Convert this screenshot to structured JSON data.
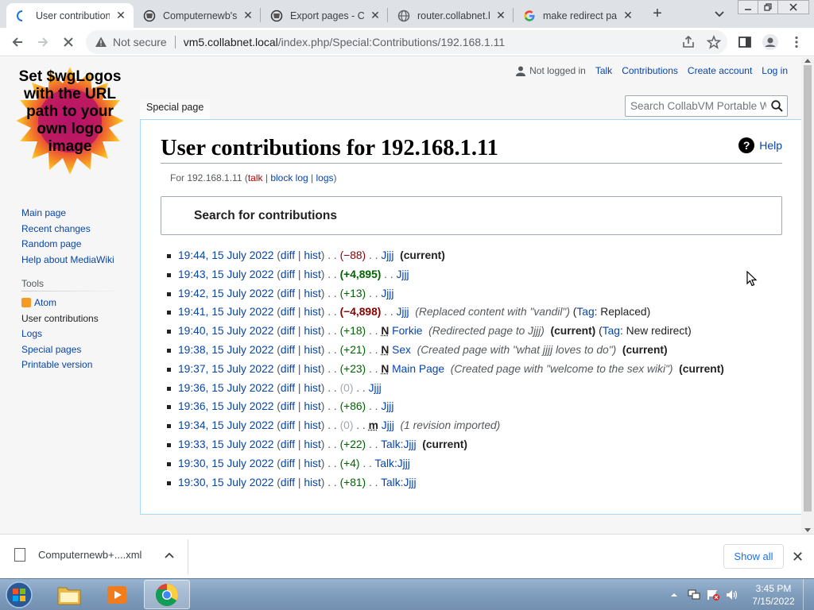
{
  "browser": {
    "tabs": [
      {
        "title": "User contribution",
        "icon": "loading-spinner-icon"
      },
      {
        "title": "Computernewb's",
        "icon": "collabvm-icon"
      },
      {
        "title": "Export pages - Co",
        "icon": "collabvm-icon"
      },
      {
        "title": "router.collabnet.lo",
        "icon": "globe-icon"
      },
      {
        "title": "make redirect pag",
        "icon": "google-icon"
      }
    ],
    "security_label": "Not secure",
    "url_host": "vm5.collabnet.local",
    "url_path": "/index.php/Special:Contributions/192.168.1.11"
  },
  "wiki": {
    "logo_text": "Set $wgLogos with the URL path to your own logo image",
    "personal": {
      "not_logged_in": "Not logged in",
      "talk": "Talk",
      "contributions": "Contributions",
      "create_account": "Create account",
      "log_in": "Log in"
    },
    "namespace_tab": "Special page",
    "search_placeholder": "Search CollabVM Portable W",
    "title": "User contributions for 192.168.1.11",
    "help": "Help",
    "subtitle": {
      "prefix": "For 192.168.1.11 (",
      "talk": "talk",
      "block_log": "block log",
      "logs": "logs",
      "suffix": ")"
    },
    "search_contribs_label": "Search for contributions",
    "navigation": [
      "Main page",
      "Recent changes",
      "Random page",
      "Help about MediaWiki"
    ],
    "tools_heading": "Tools",
    "tools": [
      "Atom",
      "User contributions",
      "Logs",
      "Special pages",
      "Printable version"
    ],
    "contributions": [
      {
        "time": "19:44, 15 July 2022",
        "size": "(−88)",
        "sizeClass": "neg",
        "flag": "",
        "page": "Jjjj",
        "summary": "",
        "tag": "",
        "current": "(current)"
      },
      {
        "time": "19:43, 15 July 2022",
        "size": "(+4,895)",
        "sizeClass": "pos strong",
        "flag": "",
        "page": "Jjjj",
        "summary": "",
        "tag": "",
        "current": ""
      },
      {
        "time": "19:42, 15 July 2022",
        "size": "(+13)",
        "sizeClass": "pos",
        "flag": "",
        "page": "Jjjj",
        "summary": "",
        "tag": "",
        "current": ""
      },
      {
        "time": "19:41, 15 July 2022",
        "size": "(−4,898)",
        "sizeClass": "neg strong",
        "flag": "",
        "page": "Jjjj",
        "summary": "(Replaced content with \"vandil\")",
        "tag": "Replaced",
        "current": ""
      },
      {
        "time": "19:40, 15 July 2022",
        "size": "(+18)",
        "sizeClass": "pos",
        "flag": "N",
        "page": "Forkie",
        "summary": "(Redirected page to Jjjj)",
        "tag": "New redirect",
        "current": "(current)"
      },
      {
        "time": "19:38, 15 July 2022",
        "size": "(+21)",
        "sizeClass": "pos",
        "flag": "N",
        "page": "Sex",
        "summary": "(Created page with \"what jjjj loves to do\")",
        "tag": "",
        "current": "(current)"
      },
      {
        "time": "19:37, 15 July 2022",
        "size": "(+23)",
        "sizeClass": "pos",
        "flag": "N",
        "page": "Main Page",
        "summary": "(Created page with \"welcome to the sex wiki\")",
        "tag": "",
        "current": "(current)"
      },
      {
        "time": "19:36, 15 July 2022",
        "size": "(0)",
        "sizeClass": "null",
        "flag": "",
        "page": "Jjjj",
        "summary": "",
        "tag": "",
        "current": ""
      },
      {
        "time": "19:36, 15 July 2022",
        "size": "(+86)",
        "sizeClass": "pos",
        "flag": "",
        "page": "Jjjj",
        "summary": "",
        "tag": "",
        "current": ""
      },
      {
        "time": "19:34, 15 July 2022",
        "size": "(0)",
        "sizeClass": "null",
        "flag": "m",
        "page": "Jjjj",
        "summary": "(1 revision imported)",
        "tag": "",
        "current": ""
      },
      {
        "time": "19:33, 15 July 2022",
        "size": "(+22)",
        "sizeClass": "pos",
        "flag": "",
        "page": "Talk:Jjjj",
        "summary": "",
        "tag": "",
        "current": "(current)"
      },
      {
        "time": "19:30, 15 July 2022",
        "size": "(+4)",
        "sizeClass": "pos",
        "flag": "",
        "page": "Talk:Jjjj",
        "summary": "",
        "tag": "",
        "current": ""
      },
      {
        "time": "19:30, 15 July 2022",
        "size": "(+81)",
        "sizeClass": "pos",
        "flag": "",
        "page": "Talk:Jjjj",
        "summary": "",
        "tag": "",
        "current": ""
      }
    ],
    "diff_label": "diff",
    "hist_label": "hist",
    "tag_label": "Tag"
  },
  "downloads": {
    "file_name": "Computernewb+....xml",
    "show_all": "Show all"
  },
  "taskbar": {
    "time": "3:45 PM",
    "date": "7/15/2022"
  }
}
